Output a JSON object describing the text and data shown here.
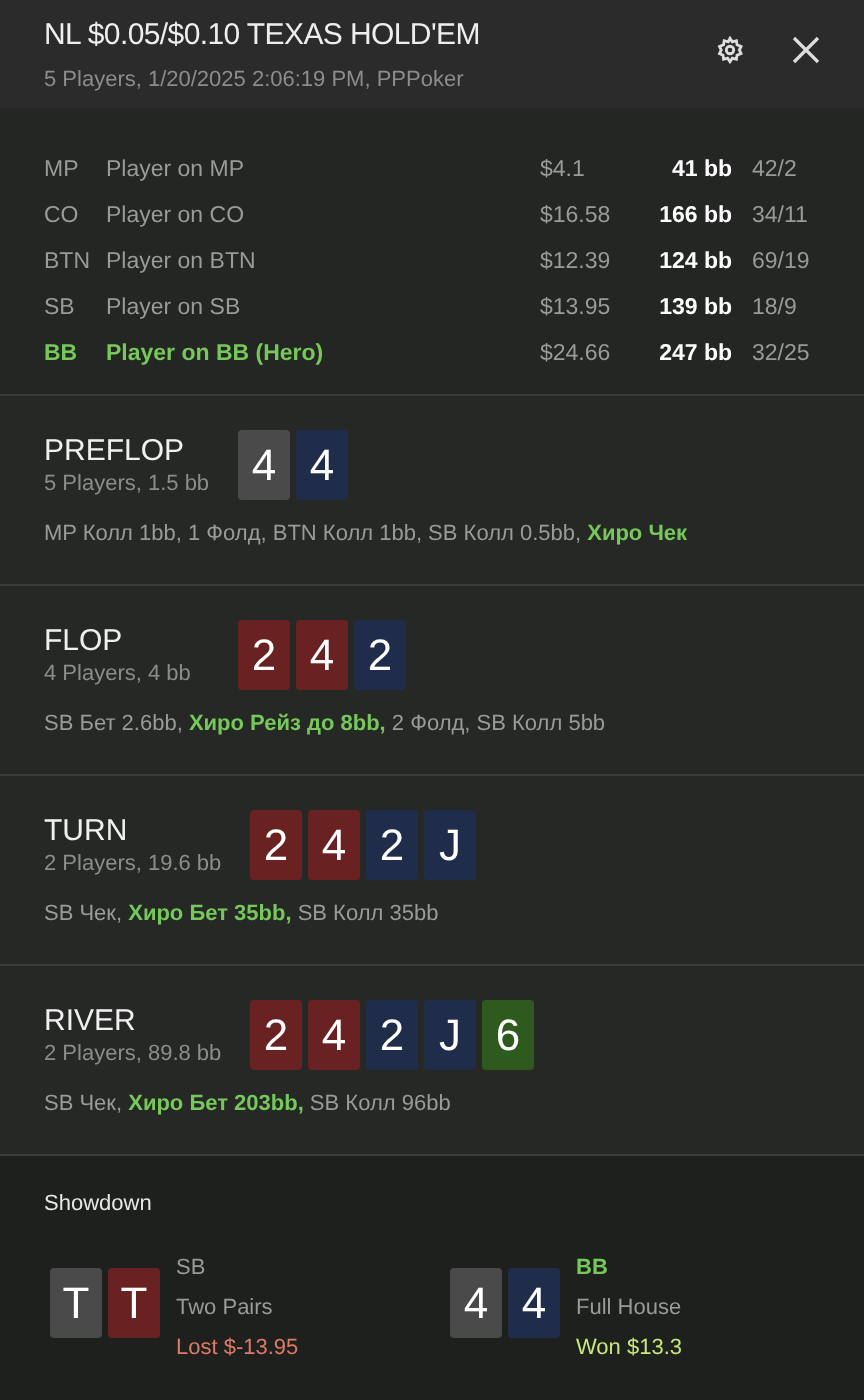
{
  "header": {
    "title": "NL $0.05/$0.10 TEXAS HOLD'EM",
    "subtitle": "5 Players, 1/20/2025 2:06:19 PM, PPPoker"
  },
  "players": [
    {
      "position": "MP",
      "name": "Player on MP",
      "stack": "$4.1",
      "bb": "41 bb",
      "stats": "42/2",
      "hero": false
    },
    {
      "position": "CO",
      "name": "Player on CO",
      "stack": "$16.58",
      "bb": "166 bb",
      "stats": "34/11",
      "hero": false
    },
    {
      "position": "BTN",
      "name": "Player on BTN",
      "stack": "$12.39",
      "bb": "124 bb",
      "stats": "69/19",
      "hero": false
    },
    {
      "position": "SB",
      "name": "Player on SB",
      "stack": "$13.95",
      "bb": "139 bb",
      "stats": "18/9",
      "hero": false
    },
    {
      "position": "BB",
      "name": "Player on BB (Hero)",
      "stack": "$24.66",
      "bb": "247 bb",
      "stats": "32/25",
      "hero": true
    }
  ],
  "streets": [
    {
      "name": "PREFLOP",
      "info": "5 Players, 1.5 bb",
      "cards": [
        {
          "rank": "4",
          "color": "#4a4a4a"
        },
        {
          "rank": "4",
          "color": "#1f2d4b"
        }
      ],
      "actions": [
        {
          "text": "MP Колл 1bb, 1 Фолд, BTN Колл 1bb, SB Колл 0.5bb, ",
          "hero": false
        },
        {
          "text": "Хиро Чек",
          "hero": true
        }
      ]
    },
    {
      "name": "FLOP",
      "info": "4 Players, 4 bb",
      "cards": [
        {
          "rank": "2",
          "color": "#6a2121"
        },
        {
          "rank": "4",
          "color": "#6a2121"
        },
        {
          "rank": "2",
          "color": "#1f2d4b"
        }
      ],
      "actions": [
        {
          "text": "SB Бет 2.6bb, ",
          "hero": false
        },
        {
          "text": "Хиро Рейз до 8bb,",
          "hero": true
        },
        {
          "text": " 2 Фолд, SB Колл 5bb",
          "hero": false
        }
      ]
    },
    {
      "name": "TURN",
      "info": "2 Players, 19.6 bb",
      "cards": [
        {
          "rank": "2",
          "color": "#6a2121"
        },
        {
          "rank": "4",
          "color": "#6a2121"
        },
        {
          "rank": "2",
          "color": "#1f2d4b"
        },
        {
          "rank": "J",
          "color": "#1f2d4b"
        }
      ],
      "actions": [
        {
          "text": "SB Чек, ",
          "hero": false
        },
        {
          "text": "Хиро Бет 35bb,",
          "hero": true
        },
        {
          "text": " SB Колл 35bb",
          "hero": false
        }
      ]
    },
    {
      "name": "RIVER",
      "info": "2 Players, 89.8 bb",
      "cards": [
        {
          "rank": "2",
          "color": "#6a2121"
        },
        {
          "rank": "4",
          "color": "#6a2121"
        },
        {
          "rank": "2",
          "color": "#1f2d4b"
        },
        {
          "rank": "J",
          "color": "#1f2d4b"
        },
        {
          "rank": "6",
          "color": "#2e5a1e"
        }
      ],
      "actions": [
        {
          "text": "SB Чек, ",
          "hero": false
        },
        {
          "text": "Хиро Бет 203bb,",
          "hero": true
        },
        {
          "text": " SB Колл 96bb",
          "hero": false
        }
      ]
    }
  ],
  "showdown": {
    "title": "Showdown",
    "hands": [
      {
        "position": "SB",
        "hero": false,
        "cards": [
          {
            "rank": "T",
            "color": "#4a4a4a"
          },
          {
            "rank": "T",
            "color": "#6a2121"
          }
        ],
        "hand": "Two Pairs",
        "result": "Lost $-13.95",
        "won": false
      },
      {
        "position": "BB",
        "hero": true,
        "cards": [
          {
            "rank": "4",
            "color": "#4a4a4a"
          },
          {
            "rank": "4",
            "color": "#1f2d4b"
          }
        ],
        "hand": "Full House",
        "result": "Won $13.3",
        "won": true
      }
    ]
  }
}
